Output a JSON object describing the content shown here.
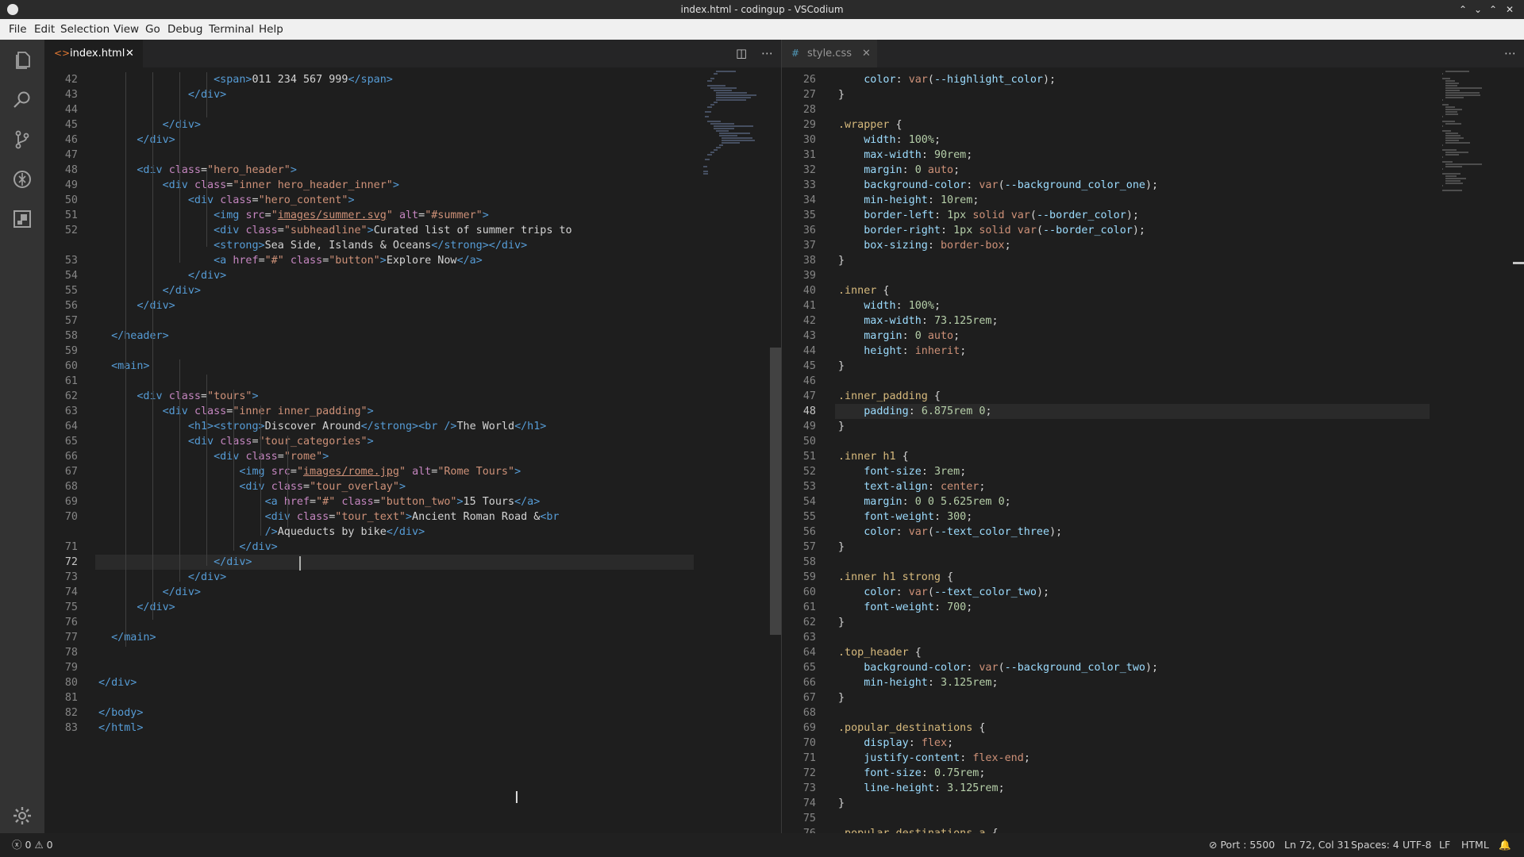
{
  "window": {
    "title": "index.html - codingup - VSCodium"
  },
  "menu": [
    "File",
    "Edit",
    "Selection",
    "View",
    "Go",
    "Debug",
    "Terminal",
    "Help"
  ],
  "activity_icons": [
    "explorer-icon",
    "search-icon",
    "source-control-icon",
    "debug-icon",
    "extensions-icon",
    "settings-icon"
  ],
  "left_editor": {
    "tab_label": "index.html",
    "tab_icon": "<>",
    "lines": [
      {
        "n": "42",
        "h": "                  <span class=\"t\">&lt;span&gt;</span><span class=\"tx\">011 234 567 999</span><span class=\"t\">&lt;/span&gt;</span>"
      },
      {
        "n": "43",
        "h": "              <span class=\"t\">&lt;/div&gt;</span>"
      },
      {
        "n": "44",
        "h": ""
      },
      {
        "n": "45",
        "h": "          <span class=\"t\">&lt;/div&gt;</span>"
      },
      {
        "n": "46",
        "h": "      <span class=\"t\">&lt;/div&gt;</span>"
      },
      {
        "n": "47",
        "h": ""
      },
      {
        "n": "48",
        "h": "      <span class=\"t\">&lt;div</span> <span class=\"an\">class</span>=<span class=\"av\">\"hero_header\"</span><span class=\"t\">&gt;</span>"
      },
      {
        "n": "49",
        "h": "          <span class=\"t\">&lt;div</span> <span class=\"an\">class</span>=<span class=\"av\">\"inner hero_header_inner\"</span><span class=\"t\">&gt;</span>"
      },
      {
        "n": "50",
        "h": "              <span class=\"t\">&lt;div</span> <span class=\"an\">class</span>=<span class=\"av\">\"hero_content\"</span><span class=\"t\">&gt;</span>"
      },
      {
        "n": "51",
        "h": "                  <span class=\"t\">&lt;img</span> <span class=\"an\">src</span>=<span class=\"av\">\"<span class=\"ul\">images/summer.svg</span>\"</span> <span class=\"an\">alt</span>=<span class=\"av\">\"#summer\"</span><span class=\"t\">&gt;</span>"
      },
      {
        "n": "52",
        "h": "                  <span class=\"t\">&lt;div</span> <span class=\"an\">class</span>=<span class=\"av\">\"subheadline\"</span><span class=\"t\">&gt;</span><span class=\"tx\">Curated list of summer trips to</span>"
      },
      {
        "n": "",
        "h": "                  <span class=\"t\">&lt;strong&gt;</span><span class=\"tx\">Sea Side, Islands &amp; Oceans</span><span class=\"t\">&lt;/strong&gt;&lt;/div&gt;</span>"
      },
      {
        "n": "53",
        "h": "                  <span class=\"t\">&lt;a</span> <span class=\"an\">href</span>=<span class=\"av\">\"#\"</span> <span class=\"an\">class</span>=<span class=\"av\">\"button\"</span><span class=\"t\">&gt;</span><span class=\"tx\">Explore Now</span><span class=\"t\">&lt;/a&gt;</span>"
      },
      {
        "n": "54",
        "h": "              <span class=\"t\">&lt;/div&gt;</span>"
      },
      {
        "n": "55",
        "h": "          <span class=\"t\">&lt;/div&gt;</span>"
      },
      {
        "n": "56",
        "h": "      <span class=\"t\">&lt;/div&gt;</span>"
      },
      {
        "n": "57",
        "h": ""
      },
      {
        "n": "58",
        "h": "  <span class=\"t\">&lt;/header&gt;</span>"
      },
      {
        "n": "59",
        "h": ""
      },
      {
        "n": "60",
        "h": "  <span class=\"t\">&lt;main&gt;</span>"
      },
      {
        "n": "61",
        "h": ""
      },
      {
        "n": "62",
        "h": "      <span class=\"t\">&lt;div</span> <span class=\"an\">class</span>=<span class=\"av\">\"tours\"</span><span class=\"t\">&gt;</span>"
      },
      {
        "n": "63",
        "h": "          <span class=\"t\">&lt;div</span> <span class=\"an\">class</span>=<span class=\"av\">\"inner inner_padding\"</span><span class=\"t\">&gt;</span>"
      },
      {
        "n": "64",
        "h": "              <span class=\"t\">&lt;h1&gt;&lt;strong&gt;</span><span class=\"tx\">Discover Around</span><span class=\"t\">&lt;/strong&gt;&lt;br</span> <span class=\"t\">/&gt;</span><span class=\"tx\">The World</span><span class=\"t\">&lt;/h1&gt;</span>"
      },
      {
        "n": "65",
        "h": "              <span class=\"t\">&lt;div</span> <span class=\"an\">class</span>=<span class=\"av\">\"tour_categories\"</span><span class=\"t\">&gt;</span>"
      },
      {
        "n": "66",
        "h": "                  <span class=\"t\">&lt;div</span> <span class=\"an\">class</span>=<span class=\"av\">\"rome\"</span><span class=\"t\">&gt;</span>"
      },
      {
        "n": "67",
        "h": "                      <span class=\"t\">&lt;img</span> <span class=\"an\">src</span>=<span class=\"av\">\"<span class=\"ul\">images/rome.jpg</span>\"</span> <span class=\"an\">alt</span>=<span class=\"av\">\"Rome Tours\"</span><span class=\"t\">&gt;</span>"
      },
      {
        "n": "68",
        "h": "                      <span class=\"t\">&lt;div</span> <span class=\"an\">class</span>=<span class=\"av\">\"tour_overlay\"</span><span class=\"t\">&gt;</span>"
      },
      {
        "n": "69",
        "h": "                          <span class=\"t\">&lt;a</span> <span class=\"an\">href</span>=<span class=\"av\">\"#\"</span> <span class=\"an\">class</span>=<span class=\"av\">\"button_two\"</span><span class=\"t\">&gt;</span><span class=\"tx\">15 Tours</span><span class=\"t\">&lt;/a&gt;</span>"
      },
      {
        "n": "70",
        "h": "                          <span class=\"t\">&lt;div</span> <span class=\"an\">class</span>=<span class=\"av\">\"tour_text\"</span><span class=\"t\">&gt;</span><span class=\"tx\">Ancient Roman Road &amp;</span><span class=\"t\">&lt;br</span>"
      },
      {
        "n": "",
        "h": "                          <span class=\"t\">/&gt;</span><span class=\"tx\">Aqueducts by bike</span><span class=\"t\">&lt;/div&gt;</span>"
      },
      {
        "n": "71",
        "h": "                      <span class=\"t\">&lt;/div&gt;</span>"
      },
      {
        "n": "72",
        "h": "                  <span class=\"t\">&lt;/div&gt;</span>"
      },
      {
        "n": "73",
        "h": "              <span class=\"t\">&lt;/div&gt;</span>"
      },
      {
        "n": "74",
        "h": "          <span class=\"t\">&lt;/div&gt;</span>"
      },
      {
        "n": "75",
        "h": "      <span class=\"t\">&lt;/div&gt;</span>"
      },
      {
        "n": "76",
        "h": ""
      },
      {
        "n": "77",
        "h": "  <span class=\"t\">&lt;/main&gt;</span>"
      },
      {
        "n": "78",
        "h": ""
      },
      {
        "n": "79",
        "h": ""
      },
      {
        "n": "80",
        "h": "<span class=\"t\">&lt;/div&gt;</span>"
      },
      {
        "n": "81",
        "h": ""
      },
      {
        "n": "82",
        "h": "<span class=\"t\">&lt;/body&gt;</span>"
      },
      {
        "n": "83",
        "h": "<span class=\"t\">&lt;/html&gt;</span>"
      }
    ]
  },
  "right_editor": {
    "tab_label": "style.css",
    "tab_icon": "#",
    "lines": [
      {
        "n": "26",
        "h": "    <span class=\"pr\">color</span>: <span class=\"kw\">var</span>(<span class=\"pr\">--highlight_color</span>);"
      },
      {
        "n": "27",
        "h": "}"
      },
      {
        "n": "28",
        "h": ""
      },
      {
        "n": "29",
        "h": "<span class=\"sel\">.wrapper</span> {"
      },
      {
        "n": "30",
        "h": "    <span class=\"pr\">width</span>: <span class=\"nm\">100%</span>;"
      },
      {
        "n": "31",
        "h": "    <span class=\"pr\">max-width</span>: <span class=\"nm\">90rem</span>;"
      },
      {
        "n": "32",
        "h": "    <span class=\"pr\">margin</span>: <span class=\"nm\">0</span> <span class=\"kw\">auto</span>;"
      },
      {
        "n": "33",
        "h": "    <span class=\"pr\">background-color</span>: <span class=\"kw\">var</span>(<span class=\"pr\">--background_color_one</span>);"
      },
      {
        "n": "34",
        "h": "    <span class=\"pr\">min-height</span>: <span class=\"nm\">10rem</span>;"
      },
      {
        "n": "35",
        "h": "    <span class=\"pr\">border-left</span>: <span class=\"nm\">1px</span> <span class=\"kw\">solid</span> <span class=\"kw\">var</span>(<span class=\"pr\">--border_color</span>);"
      },
      {
        "n": "36",
        "h": "    <span class=\"pr\">border-right</span>: <span class=\"nm\">1px</span> <span class=\"kw\">solid</span> <span class=\"kw\">var</span>(<span class=\"pr\">--border_color</span>);"
      },
      {
        "n": "37",
        "h": "    <span class=\"pr\">box-sizing</span>: <span class=\"kw\">border-box</span>;"
      },
      {
        "n": "38",
        "h": "}"
      },
      {
        "n": "39",
        "h": ""
      },
      {
        "n": "40",
        "h": "<span class=\"sel\">.inner</span> {"
      },
      {
        "n": "41",
        "h": "    <span class=\"pr\">width</span>: <span class=\"nm\">100%</span>;"
      },
      {
        "n": "42",
        "h": "    <span class=\"pr\">max-width</span>: <span class=\"nm\">73.125rem</span>;"
      },
      {
        "n": "43",
        "h": "    <span class=\"pr\">margin</span>: <span class=\"nm\">0</span> <span class=\"kw\">auto</span>;"
      },
      {
        "n": "44",
        "h": "    <span class=\"pr\">height</span>: <span class=\"kw\">inherit</span>;"
      },
      {
        "n": "45",
        "h": "}"
      },
      {
        "n": "46",
        "h": ""
      },
      {
        "n": "47",
        "h": "<span class=\"sel\">.inner_padding</span> {"
      },
      {
        "n": "48",
        "h": "    <span class=\"pr\">padding</span>: <span class=\"nm\">6.875rem</span> <span class=\"nm\">0</span>;"
      },
      {
        "n": "49",
        "h": "}"
      },
      {
        "n": "50",
        "h": ""
      },
      {
        "n": "51",
        "h": "<span class=\"sel\">.inner h1</span> {"
      },
      {
        "n": "52",
        "h": "    <span class=\"pr\">font-size</span>: <span class=\"nm\">3rem</span>;"
      },
      {
        "n": "53",
        "h": "    <span class=\"pr\">text-align</span>: <span class=\"kw\">center</span>;"
      },
      {
        "n": "54",
        "h": "    <span class=\"pr\">margin</span>: <span class=\"nm\">0</span> <span class=\"nm\">0</span> <span class=\"nm\">5.625rem</span> <span class=\"nm\">0</span>;"
      },
      {
        "n": "55",
        "h": "    <span class=\"pr\">font-weight</span>: <span class=\"nm\">300</span>;"
      },
      {
        "n": "56",
        "h": "    <span class=\"pr\">color</span>: <span class=\"kw\">var</span>(<span class=\"pr\">--text_color_three</span>);"
      },
      {
        "n": "57",
        "h": "}"
      },
      {
        "n": "58",
        "h": ""
      },
      {
        "n": "59",
        "h": "<span class=\"sel\">.inner h1 strong</span> {"
      },
      {
        "n": "60",
        "h": "    <span class=\"pr\">color</span>: <span class=\"kw\">var</span>(<span class=\"pr\">--text_color_two</span>);"
      },
      {
        "n": "61",
        "h": "    <span class=\"pr\">font-weight</span>: <span class=\"nm\">700</span>;"
      },
      {
        "n": "62",
        "h": "}"
      },
      {
        "n": "63",
        "h": ""
      },
      {
        "n": "64",
        "h": "<span class=\"sel\">.top_header</span> {"
      },
      {
        "n": "65",
        "h": "    <span class=\"pr\">background-color</span>: <span class=\"kw\">var</span>(<span class=\"pr\">--background_color_two</span>);"
      },
      {
        "n": "66",
        "h": "    <span class=\"pr\">min-height</span>: <span class=\"nm\">3.125rem</span>;"
      },
      {
        "n": "67",
        "h": "}"
      },
      {
        "n": "68",
        "h": ""
      },
      {
        "n": "69",
        "h": "<span class=\"sel\">.popular_destinations</span> {"
      },
      {
        "n": "70",
        "h": "    <span class=\"pr\">display</span>: <span class=\"kw\">flex</span>;"
      },
      {
        "n": "71",
        "h": "    <span class=\"pr\">justify-content</span>: <span class=\"kw\">flex-end</span>;"
      },
      {
        "n": "72",
        "h": "    <span class=\"pr\">font-size</span>: <span class=\"nm\">0.75rem</span>;"
      },
      {
        "n": "73",
        "h": "    <span class=\"pr\">line-height</span>: <span class=\"nm\">3.125rem</span>;"
      },
      {
        "n": "74",
        "h": "}"
      },
      {
        "n": "75",
        "h": ""
      },
      {
        "n": "76",
        "h": "<span class=\"sel\">.popular_destinations a</span> {"
      }
    ]
  },
  "status": {
    "problems": "0",
    "warnings": "0",
    "port": "Port : 5500",
    "position": "Ln 72, Col 31",
    "spaces": "Spaces: 4",
    "encoding": "UTF-8",
    "eol": "LF",
    "language": "HTML"
  },
  "colors": {
    "editor_bg": "#1e1e1e",
    "activity_bg": "#333333",
    "tag": "#569cd6",
    "attr_name": "#c586c0",
    "attr_value": "#ce9178",
    "css_selector": "#d7ba7d",
    "css_property": "#9cdcfe",
    "css_number": "#b5cea8"
  }
}
